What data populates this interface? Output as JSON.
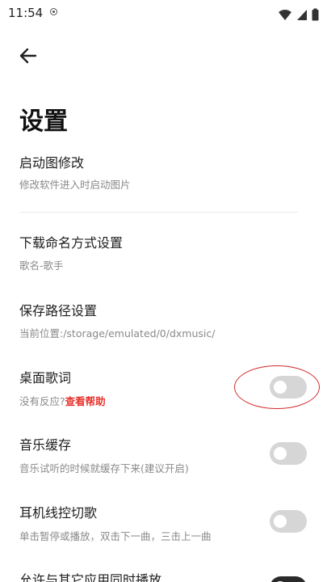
{
  "status_bar": {
    "time": "11:54"
  },
  "page": {
    "title": "设置"
  },
  "settings": [
    {
      "title": "启动图修改",
      "subtitle": "修改软件进入时启动图片"
    },
    {
      "title": "下载命名方式设置",
      "subtitle": "歌名-歌手"
    },
    {
      "title": "保存路径设置",
      "subtitle": "当前位置:/storage/emulated/0/dxmusic/"
    },
    {
      "title": "桌面歌词",
      "subtitle": "没有反应?",
      "link": "查看帮助",
      "toggle": false
    },
    {
      "title": "音乐缓存",
      "subtitle": "音乐试听的时候就缓存下来(建议开启)",
      "toggle": false
    },
    {
      "title": "耳机线控切歌",
      "subtitle": "单击暂停或播放，双击下一曲，三击上一曲",
      "toggle": false
    },
    {
      "title": "允许与其它应用同时播放",
      "toggle": true
    }
  ],
  "icons": {
    "back": "arrow-left-icon",
    "wifi": "wifi-icon",
    "signal": "cell-signal-icon",
    "battery": "battery-icon",
    "notification": "notification-dot-icon"
  },
  "colors": {
    "link": "#e8332b",
    "toggle_off": "#d6d6d6",
    "toggle_on": "#2a2a2a",
    "highlight": "#d42a2a"
  }
}
